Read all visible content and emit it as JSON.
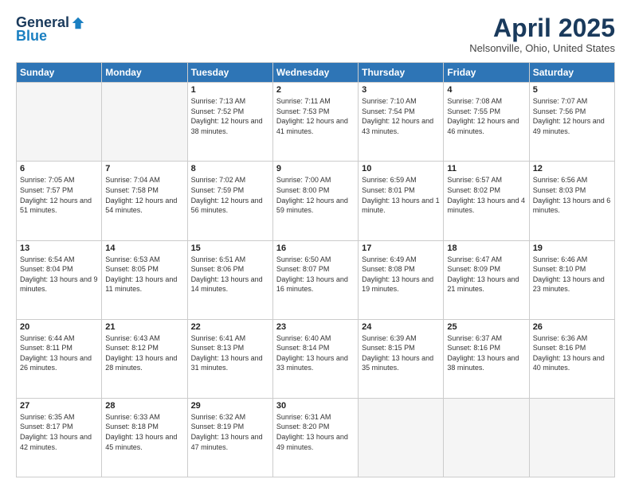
{
  "logo": {
    "general": "General",
    "blue": "Blue"
  },
  "header": {
    "month": "April 2025",
    "location": "Nelsonville, Ohio, United States"
  },
  "days_of_week": [
    "Sunday",
    "Monday",
    "Tuesday",
    "Wednesday",
    "Thursday",
    "Friday",
    "Saturday"
  ],
  "weeks": [
    [
      {
        "day": "",
        "info": ""
      },
      {
        "day": "",
        "info": ""
      },
      {
        "day": "1",
        "info": "Sunrise: 7:13 AM\nSunset: 7:52 PM\nDaylight: 12 hours and 38 minutes."
      },
      {
        "day": "2",
        "info": "Sunrise: 7:11 AM\nSunset: 7:53 PM\nDaylight: 12 hours and 41 minutes."
      },
      {
        "day": "3",
        "info": "Sunrise: 7:10 AM\nSunset: 7:54 PM\nDaylight: 12 hours and 43 minutes."
      },
      {
        "day": "4",
        "info": "Sunrise: 7:08 AM\nSunset: 7:55 PM\nDaylight: 12 hours and 46 minutes."
      },
      {
        "day": "5",
        "info": "Sunrise: 7:07 AM\nSunset: 7:56 PM\nDaylight: 12 hours and 49 minutes."
      }
    ],
    [
      {
        "day": "6",
        "info": "Sunrise: 7:05 AM\nSunset: 7:57 PM\nDaylight: 12 hours and 51 minutes."
      },
      {
        "day": "7",
        "info": "Sunrise: 7:04 AM\nSunset: 7:58 PM\nDaylight: 12 hours and 54 minutes."
      },
      {
        "day": "8",
        "info": "Sunrise: 7:02 AM\nSunset: 7:59 PM\nDaylight: 12 hours and 56 minutes."
      },
      {
        "day": "9",
        "info": "Sunrise: 7:00 AM\nSunset: 8:00 PM\nDaylight: 12 hours and 59 minutes."
      },
      {
        "day": "10",
        "info": "Sunrise: 6:59 AM\nSunset: 8:01 PM\nDaylight: 13 hours and 1 minute."
      },
      {
        "day": "11",
        "info": "Sunrise: 6:57 AM\nSunset: 8:02 PM\nDaylight: 13 hours and 4 minutes."
      },
      {
        "day": "12",
        "info": "Sunrise: 6:56 AM\nSunset: 8:03 PM\nDaylight: 13 hours and 6 minutes."
      }
    ],
    [
      {
        "day": "13",
        "info": "Sunrise: 6:54 AM\nSunset: 8:04 PM\nDaylight: 13 hours and 9 minutes."
      },
      {
        "day": "14",
        "info": "Sunrise: 6:53 AM\nSunset: 8:05 PM\nDaylight: 13 hours and 11 minutes."
      },
      {
        "day": "15",
        "info": "Sunrise: 6:51 AM\nSunset: 8:06 PM\nDaylight: 13 hours and 14 minutes."
      },
      {
        "day": "16",
        "info": "Sunrise: 6:50 AM\nSunset: 8:07 PM\nDaylight: 13 hours and 16 minutes."
      },
      {
        "day": "17",
        "info": "Sunrise: 6:49 AM\nSunset: 8:08 PM\nDaylight: 13 hours and 19 minutes."
      },
      {
        "day": "18",
        "info": "Sunrise: 6:47 AM\nSunset: 8:09 PM\nDaylight: 13 hours and 21 minutes."
      },
      {
        "day": "19",
        "info": "Sunrise: 6:46 AM\nSunset: 8:10 PM\nDaylight: 13 hours and 23 minutes."
      }
    ],
    [
      {
        "day": "20",
        "info": "Sunrise: 6:44 AM\nSunset: 8:11 PM\nDaylight: 13 hours and 26 minutes."
      },
      {
        "day": "21",
        "info": "Sunrise: 6:43 AM\nSunset: 8:12 PM\nDaylight: 13 hours and 28 minutes."
      },
      {
        "day": "22",
        "info": "Sunrise: 6:41 AM\nSunset: 8:13 PM\nDaylight: 13 hours and 31 minutes."
      },
      {
        "day": "23",
        "info": "Sunrise: 6:40 AM\nSunset: 8:14 PM\nDaylight: 13 hours and 33 minutes."
      },
      {
        "day": "24",
        "info": "Sunrise: 6:39 AM\nSunset: 8:15 PM\nDaylight: 13 hours and 35 minutes."
      },
      {
        "day": "25",
        "info": "Sunrise: 6:37 AM\nSunset: 8:16 PM\nDaylight: 13 hours and 38 minutes."
      },
      {
        "day": "26",
        "info": "Sunrise: 6:36 AM\nSunset: 8:16 PM\nDaylight: 13 hours and 40 minutes."
      }
    ],
    [
      {
        "day": "27",
        "info": "Sunrise: 6:35 AM\nSunset: 8:17 PM\nDaylight: 13 hours and 42 minutes."
      },
      {
        "day": "28",
        "info": "Sunrise: 6:33 AM\nSunset: 8:18 PM\nDaylight: 13 hours and 45 minutes."
      },
      {
        "day": "29",
        "info": "Sunrise: 6:32 AM\nSunset: 8:19 PM\nDaylight: 13 hours and 47 minutes."
      },
      {
        "day": "30",
        "info": "Sunrise: 6:31 AM\nSunset: 8:20 PM\nDaylight: 13 hours and 49 minutes."
      },
      {
        "day": "",
        "info": ""
      },
      {
        "day": "",
        "info": ""
      },
      {
        "day": "",
        "info": ""
      }
    ]
  ]
}
